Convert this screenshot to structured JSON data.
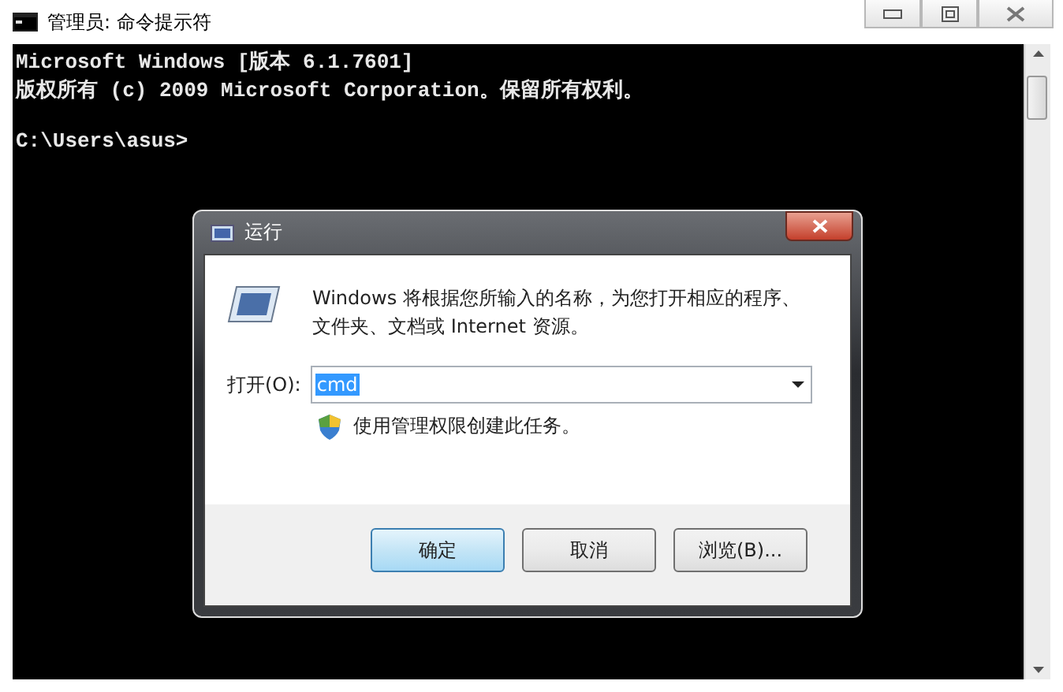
{
  "window": {
    "title": "管理员: 命令提示符"
  },
  "console": {
    "banner": [
      "Microsoft Windows [版本 6.1.7601]",
      "版权所有 (c) 2009 Microsoft Corporation。保留所有权利。"
    ],
    "prompt": "C:\\Users\\asus>"
  },
  "run_dialog": {
    "title": "运行",
    "description_lines": [
      "Windows 将根据您所输入的名称，为您打开相应的程序、",
      "文件夹、文档或 Internet 资源。"
    ],
    "open_label": "打开(O):",
    "open_value": "cmd",
    "value_selected": true,
    "admin_note": "使用管理权限创建此任务。",
    "buttons": [
      {
        "label": "确定",
        "default": true
      },
      {
        "label": "取消",
        "default": false
      },
      {
        "label": "浏览(B)...",
        "default": false
      }
    ]
  }
}
